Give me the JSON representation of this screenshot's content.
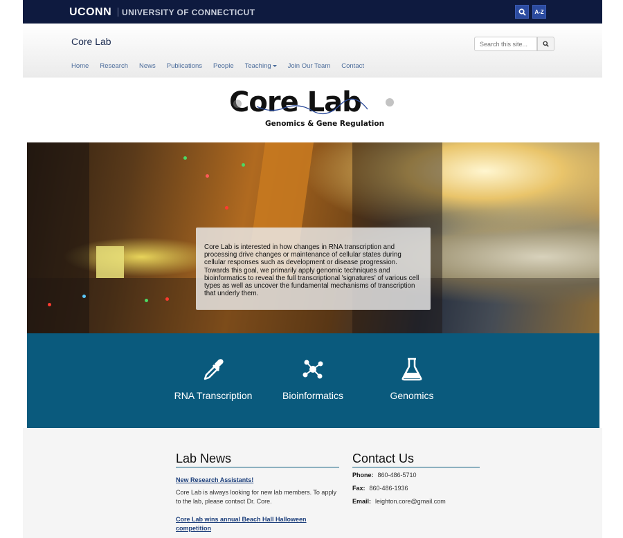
{
  "uconn_bar": {
    "logo": "UCONN",
    "university": "UNIVERSITY OF CONNECTICUT",
    "search_icon": "search-icon",
    "az_label": "A-Z"
  },
  "header": {
    "site_title": "Core Lab",
    "search_placeholder": "Search this site...",
    "nav": [
      "Home",
      "Research",
      "News",
      "Publications",
      "People",
      "Teaching",
      "Join Our Team",
      "Contact"
    ]
  },
  "logo": {
    "title": "Core Lab",
    "subtitle": "Genomics & Gene Regulation"
  },
  "hero": {
    "text": "Core Lab is interested in how changes in RNA transcription and processing drive changes or maintenance of cellular states during cellular responses such as development or disease progression. Towards this goal, we primarily apply genomic techniques and bioinformatics to reveal the full transcriptional 'signatures' of various cell types as well as uncover the fundamental mechanisms of transcription that underly them."
  },
  "features": [
    {
      "label": "RNA Transcription",
      "icon": "dropper-icon"
    },
    {
      "label": "Bioinformatics",
      "icon": "network-icon"
    },
    {
      "label": "Genomics",
      "icon": "flask-icon"
    }
  ],
  "lab_news": {
    "heading": "Lab News",
    "items": [
      {
        "title": "New Research Assistants!",
        "body": "Core Lab is always looking for new lab members. To apply to the lab, please contact Dr. Core."
      },
      {
        "title": "Core Lab wins annual Beach Hall Halloween competition",
        "body": ""
      }
    ]
  },
  "contact": {
    "heading": "Contact Us",
    "phone_label": "Phone:",
    "phone": "860-486-5710",
    "fax_label": "Fax:",
    "fax": "860-486-1936",
    "email_label": "Email:",
    "email": "leighton.core@gmail.com"
  },
  "colors": {
    "top_bar": "#0e1a3f",
    "band": "#0a5a7d",
    "link": "#1a3d7a"
  }
}
